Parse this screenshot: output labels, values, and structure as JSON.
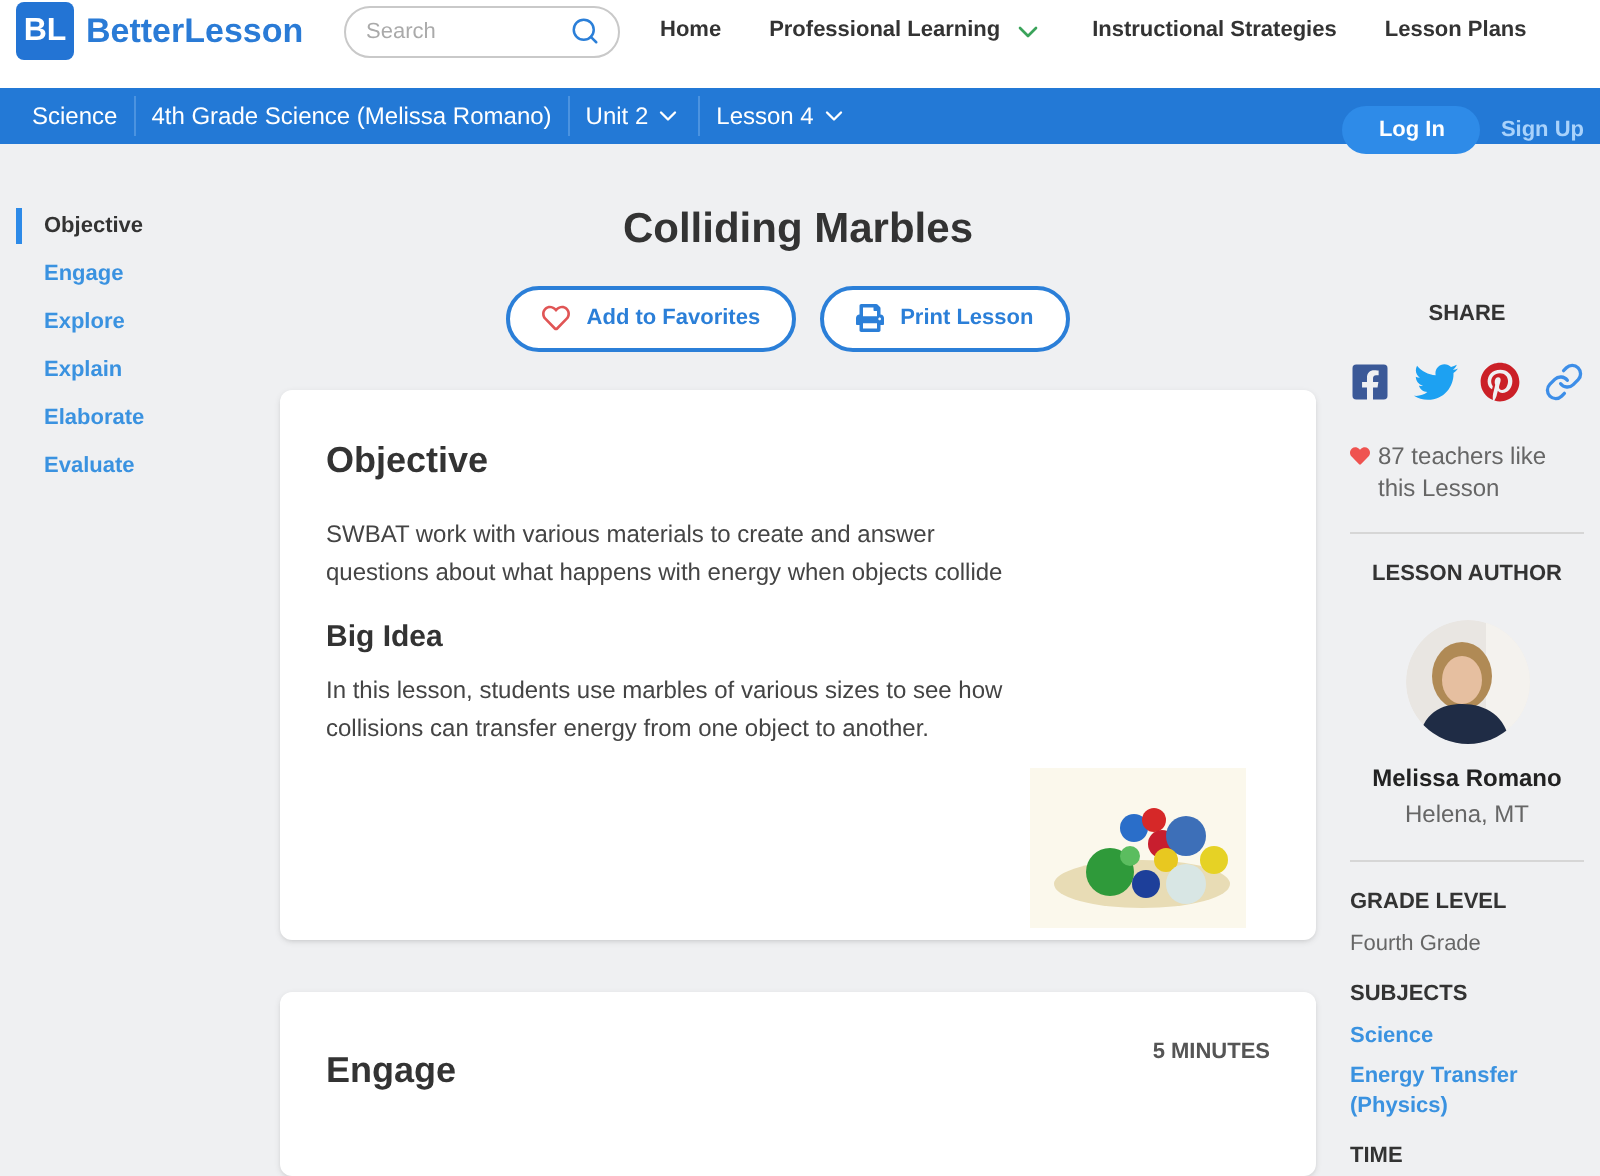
{
  "header": {
    "logo_mark": "BL",
    "logo_text": "BetterLesson",
    "search": {
      "placeholder": "Search"
    },
    "nav": [
      {
        "label": "Home",
        "dropdown": false
      },
      {
        "label": "Professional Learning",
        "dropdown": true
      },
      {
        "label": "Instructional Strategies",
        "dropdown": false
      },
      {
        "label": "Lesson Plans",
        "dropdown": false
      }
    ]
  },
  "breadcrumb": [
    {
      "label": "Science",
      "dropdown": false
    },
    {
      "label": "4th Grade Science (Melissa Romano)",
      "dropdown": false
    },
    {
      "label": "Unit 2",
      "dropdown": true
    },
    {
      "label": "Lesson 4",
      "dropdown": true
    }
  ],
  "auth": {
    "login": "Log In",
    "signup": "Sign Up"
  },
  "sidebar": {
    "items": [
      {
        "label": "Objective",
        "selected": true
      },
      {
        "label": "Engage",
        "selected": false
      },
      {
        "label": "Explore",
        "selected": false
      },
      {
        "label": "Explain",
        "selected": false
      },
      {
        "label": "Elaborate",
        "selected": false
      },
      {
        "label": "Evaluate",
        "selected": false
      }
    ]
  },
  "lesson": {
    "title": "Colliding Marbles",
    "actions": [
      {
        "kind": "favorite",
        "label": "Add to Favorites"
      },
      {
        "kind": "print",
        "label": "Print Lesson"
      }
    ]
  },
  "objective_card": {
    "heading": "Objective",
    "text": "SWBAT work with various materials to create and answer questions about what happens with energy when objects collide",
    "big_idea_heading": "Big Idea",
    "big_idea": "In this lesson, students use marbles of various sizes to see how collisions can transfer energy from one object to another."
  },
  "engage_card": {
    "heading": "Engage",
    "duration": "5 MINUTES"
  },
  "aside": {
    "share_heading": "SHARE",
    "share": [
      {
        "kind": "facebook"
      },
      {
        "kind": "twitter"
      },
      {
        "kind": "pinterest"
      },
      {
        "kind": "link"
      }
    ],
    "likes": "87 teachers like this Lesson",
    "author_heading": "LESSON AUTHOR",
    "author_name": "Melissa Romano",
    "author_location": "Helena, MT",
    "grade_heading": "GRADE LEVEL",
    "grade": "Fourth Grade",
    "subjects_heading": "SUBJECTS",
    "subjects": [
      "Science",
      "Energy Transfer (Physics)"
    ],
    "time_heading": "TIME"
  }
}
